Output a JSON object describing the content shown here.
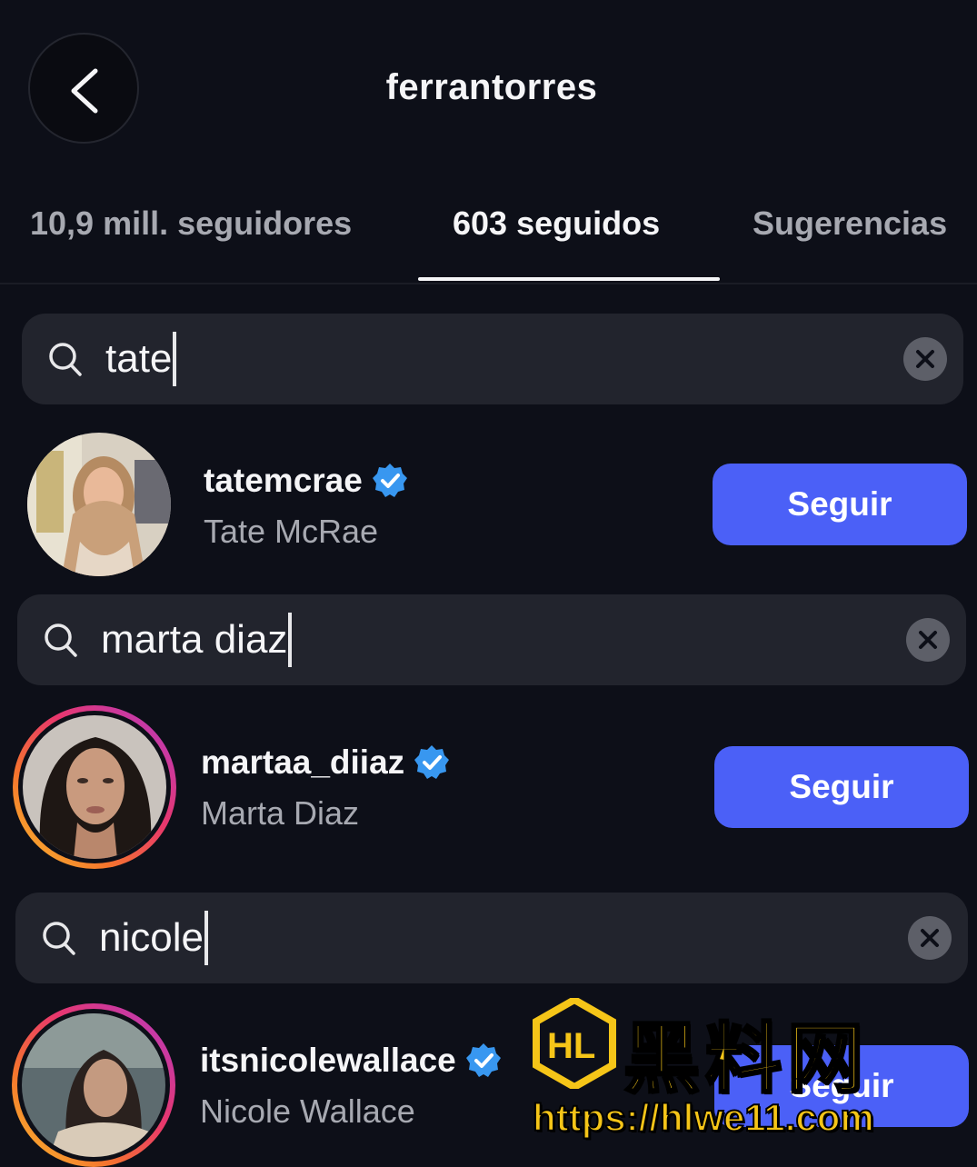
{
  "header": {
    "title": "ferrantorres",
    "back_icon": "chevron-left-icon"
  },
  "tabs": [
    {
      "label": "10,9 mill. seguidores",
      "active": false
    },
    {
      "label": "603 seguidos",
      "active": true
    },
    {
      "label": "Sugerencias",
      "active": false
    }
  ],
  "searches": [
    {
      "query": "tate"
    },
    {
      "query": "marta diaz"
    },
    {
      "query": "nicole"
    }
  ],
  "results": [
    {
      "username": "tatemcrae",
      "full_name": "Tate McRae",
      "verified": true,
      "button": "Seguir",
      "has_story": false
    },
    {
      "username": "martaa_diiaz",
      "full_name": "Marta Diaz",
      "verified": true,
      "button": "Seguir",
      "has_story": true
    },
    {
      "username": "itsnicolewallace",
      "full_name": "Nicole Wallace",
      "verified": true,
      "button": "Seguir",
      "has_story": true
    }
  ],
  "watermark": {
    "text": "黑料网",
    "url": "https://hlwe11.com"
  },
  "colors": {
    "background": "#0d0f18",
    "search_bg": "#22242d",
    "follow_button": "#4b60f7",
    "verified_badge": "#3897f0",
    "secondary_text": "#a7a9b1",
    "watermark": "#f5c518"
  }
}
